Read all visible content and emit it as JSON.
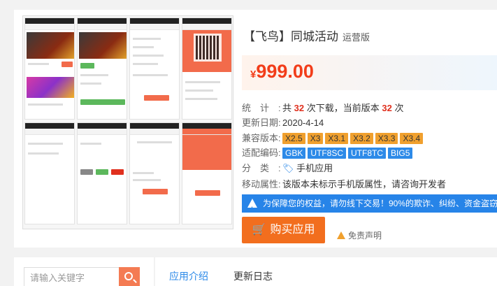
{
  "product": {
    "title": "【飞鸟】同城活动",
    "edition": "运营版",
    "currency": "¥",
    "price": "999.00"
  },
  "stats": {
    "label": "统计:",
    "prefix": "共",
    "downloads": "32",
    "middle": "次下载，当前版本",
    "version_count": "32",
    "suffix": "次"
  },
  "updated": {
    "label": "更新日期:",
    "value": "2020-4-14"
  },
  "compat": {
    "label": "兼容版本:",
    "tags": [
      "X2.5",
      "X3",
      "X3.1",
      "X3.2",
      "X3.3",
      "X3.4"
    ]
  },
  "encoding": {
    "label": "适配编码:",
    "tags": [
      "GBK",
      "UTF8SC",
      "UTF8TC",
      "BIG5"
    ]
  },
  "category": {
    "label": "分类:",
    "value": "手机应用"
  },
  "mobile": {
    "label": "移动属性:",
    "value": "该版本未标示手机版属性，请咨询开发者"
  },
  "notice": {
    "text": "为保障您的权益，请勿线下交易！90%的欺诈、纠纷、资金盗窃"
  },
  "actions": {
    "buy_label": "购买应用",
    "disclaimer": "免责声明"
  },
  "search": {
    "placeholder": "请输入关键字"
  },
  "tabs": [
    {
      "label": "应用介绍"
    },
    {
      "label": "更新日志"
    }
  ],
  "colors": {
    "accent_orange": "#f26e1e",
    "price_red": "#f23d1a",
    "tag_blue": "#2d8ae8",
    "tag_orange": "#f0a02e"
  }
}
